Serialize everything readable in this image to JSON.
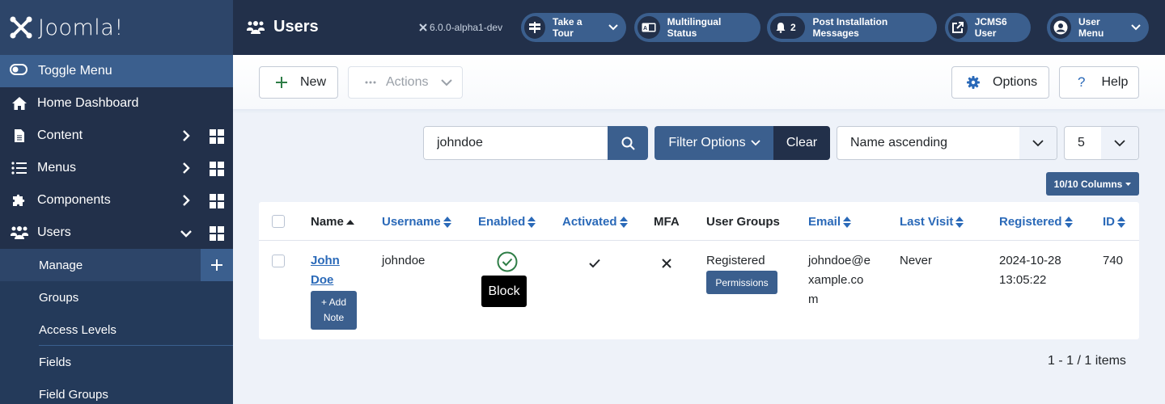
{
  "sidebar": {
    "logo_text": "Joomla!",
    "toggle_label": "Toggle Menu",
    "items": [
      {
        "label": "Home Dashboard",
        "icon": "home-icon"
      },
      {
        "label": "Content",
        "icon": "file-icon",
        "expandable": true
      },
      {
        "label": "Menus",
        "icon": "list-icon",
        "expandable": true
      },
      {
        "label": "Components",
        "icon": "puzzle-icon",
        "expandable": true
      },
      {
        "label": "Users",
        "icon": "users-icon",
        "expanded": true
      }
    ],
    "sub_items": [
      {
        "label": "Manage",
        "active": true
      },
      {
        "label": "Groups"
      },
      {
        "label": "Access Levels"
      },
      {
        "label": "Fields"
      },
      {
        "label": "Field Groups"
      }
    ]
  },
  "header": {
    "title": "Users",
    "version": "6.0.0-alpha1-dev",
    "pills": [
      {
        "label": "Take a Tour",
        "icon": "signpost-icon"
      },
      {
        "label": "Multilingual Status",
        "icon": "language-icon"
      },
      {
        "label": "Post Installation Messages",
        "icon": "bell-icon",
        "count": "2"
      },
      {
        "label": "JCMS6 User",
        "icon": "external-link-icon"
      },
      {
        "label": "User Menu",
        "icon": "user-circle-icon"
      }
    ]
  },
  "toolbar": {
    "new_label": "New",
    "actions_label": "Actions",
    "options_label": "Options",
    "help_label": "Help"
  },
  "filters": {
    "search_value": "johndoe",
    "filter_options_label": "Filter Options",
    "clear_label": "Clear",
    "sort_value": "Name ascending",
    "limit_value": "5",
    "columns_label": "10/10 Columns"
  },
  "table": {
    "headers": {
      "name": "Name",
      "username": "Username",
      "enabled": "Enabled",
      "activated": "Activated",
      "mfa": "MFA",
      "user_groups": "User Groups",
      "email": "Email",
      "last_visit": "Last Visit",
      "registered": "Registered",
      "id": "ID"
    },
    "rows": [
      {
        "name_line1": "John",
        "name_line2": "Doe",
        "add_note_line1": "+ Add",
        "add_note_line2": "Note",
        "username": "johndoe",
        "enabled_tooltip": "Block",
        "user_group": "Registered",
        "permissions_label": "Permissions",
        "email_line1": "johndoe@e",
        "email_line2": "xample.co",
        "email_line3": "m",
        "last_visit": "Never",
        "registered_date": "2024-10-28",
        "registered_time": "13:05:22",
        "id": "740"
      }
    ]
  },
  "pagination": {
    "summary": "1 - 1 / 1 items"
  },
  "colors": {
    "primary": "#3b5f8e",
    "dark": "#22304a",
    "link": "#2a69b8",
    "success": "#2e7d46"
  }
}
